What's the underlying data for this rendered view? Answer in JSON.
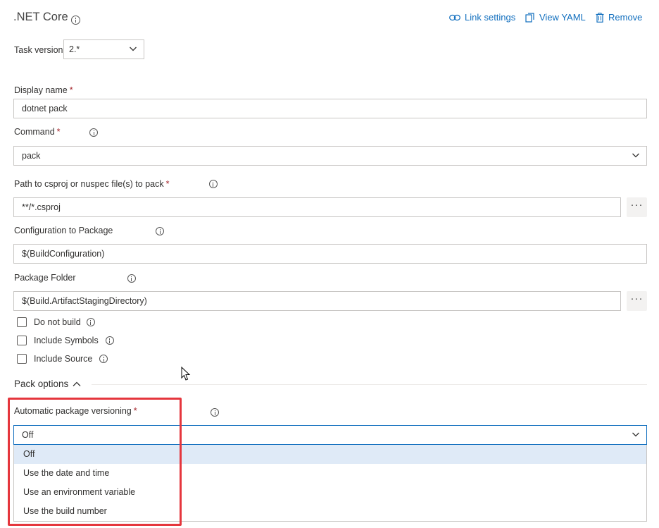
{
  "header": {
    "title": ".NET Core",
    "link_settings": "Link settings",
    "view_yaml": "View YAML",
    "remove": "Remove"
  },
  "task_version": {
    "label": "Task version",
    "value": "2.*"
  },
  "display_name": {
    "label": "Display name",
    "value": "dotnet pack"
  },
  "command": {
    "label": "Command",
    "value": "pack"
  },
  "path": {
    "label": "Path to csproj or nuspec file(s) to pack",
    "value": "**/*.csproj",
    "more": "···"
  },
  "configuration": {
    "label": "Configuration to Package",
    "value": "$(BuildConfiguration)"
  },
  "package_folder": {
    "label": "Package Folder",
    "value": "$(Build.ArtifactStagingDirectory)",
    "more": "···"
  },
  "checkboxes": [
    {
      "label": "Do not build",
      "checked": false
    },
    {
      "label": "Include Symbols",
      "checked": false
    },
    {
      "label": "Include Source",
      "checked": false
    }
  ],
  "pack_options": {
    "label": "Pack options"
  },
  "versioning": {
    "label": "Automatic package versioning",
    "value": "Off",
    "options": [
      "Off",
      "Use the date and time",
      "Use an environment variable",
      "Use the build number"
    ],
    "selected_index": 0
  },
  "colors": {
    "accent": "#106ebe",
    "required": "#a4262c",
    "selected_option_bg": "#dfeaf7",
    "highlight_box": "#e5363d"
  }
}
